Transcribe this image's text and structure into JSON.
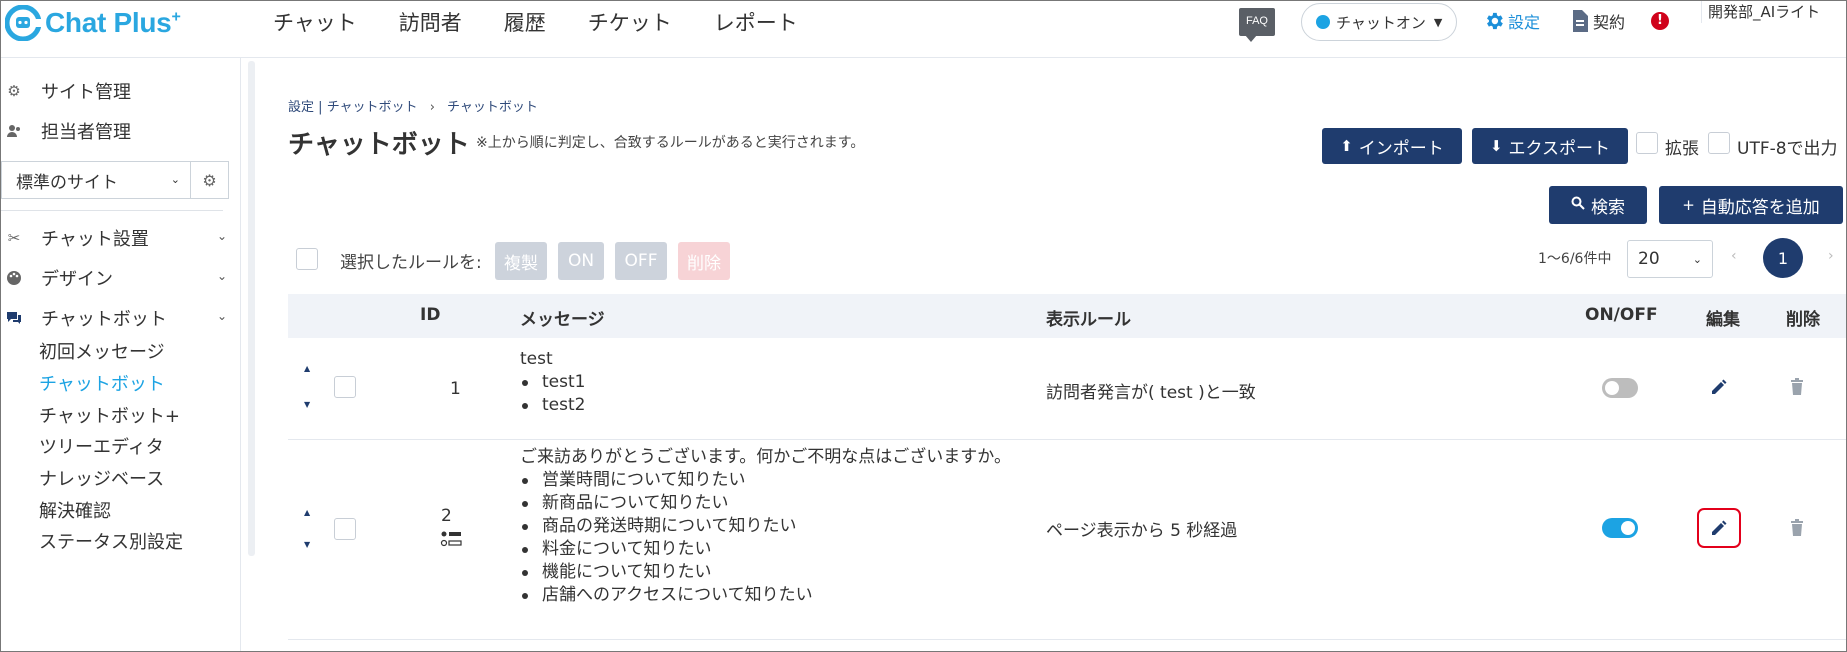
{
  "app": {
    "logo_text": "Chat Plus",
    "logo_plus": "+"
  },
  "nav": {
    "items": [
      "チャット",
      "訪問者",
      "履歴",
      "チケット",
      "レポート"
    ]
  },
  "header": {
    "faq_label": "FAQ",
    "status_label": "チャットオン",
    "settings_label": "設定",
    "contract_label": "契約",
    "alert_glyph": "!",
    "user_name": "開発部_AIライト"
  },
  "sidebar": {
    "top_items": [
      {
        "label": "サイト管理",
        "icon": "gear-icon"
      },
      {
        "label": "担当者管理",
        "icon": "users-icon"
      }
    ],
    "site_select_value": "標準のサイト",
    "sections": [
      {
        "label": "チャット設置",
        "icon": "tools-icon"
      },
      {
        "label": "デザイン",
        "icon": "palette-icon"
      },
      {
        "label": "チャットボット",
        "icon": "chat-icon"
      }
    ],
    "sub_items": [
      "初回メッセージ",
      "チャットボット",
      "チャットボット+",
      "ツリーエディタ",
      "ナレッジベース",
      "解決確認",
      "ステータス別設定"
    ],
    "active_sub": "チャットボット"
  },
  "breadcrumb": {
    "root": "設定",
    "sep1": "|",
    "level1": "チャットボット",
    "sep2": "›",
    "level2": "チャットボット"
  },
  "page": {
    "title": "チャットボット",
    "note": "※上から順に判定し、合致するルールがあると実行されます。"
  },
  "toolbar": {
    "import_label": "インポート",
    "export_label": "エクスポート",
    "expand_label": "拡張",
    "utf8_label": "UTF-8で出力",
    "search_label": "検索",
    "add_label": "自動応答を追加"
  },
  "bulk": {
    "label": "選択したルールを:",
    "copy": "複製",
    "on": "ON",
    "off": "OFF",
    "delete": "削除"
  },
  "pagination": {
    "info": "1～6/6件中",
    "per_page": "20",
    "current": "1",
    "prev": "‹",
    "next": "›"
  },
  "table": {
    "headers": {
      "id": "ID",
      "message": "メッセージ",
      "rule": "表示ルール",
      "onoff": "ON/OFF",
      "edit": "編集",
      "delete": "削除"
    },
    "rows": [
      {
        "id": "1",
        "message_title": "test",
        "message_items": [
          "test1",
          "test2"
        ],
        "rule": "訪問者発言が( test )と一致",
        "enabled": false
      },
      {
        "id": "2",
        "message_title": "ご来訪ありがとうございます。何かご不明な点はございますか。",
        "message_items": [
          "営業時間について知りたい",
          "新商品について知りたい",
          "商品の発送時期について知りたい",
          "料金について知りたい",
          "機能について知りたい",
          "店舗へのアクセスについて知りたい"
        ],
        "rule": "ページ表示から 5 秒経過",
        "enabled": true
      }
    ]
  },
  "colors": {
    "brand": "#2aa7e0",
    "navy": "#1f3c6e",
    "toggle_on": "#1ca3e3",
    "toggle_off": "#bdbdbd",
    "highlight": "#e3001b"
  }
}
